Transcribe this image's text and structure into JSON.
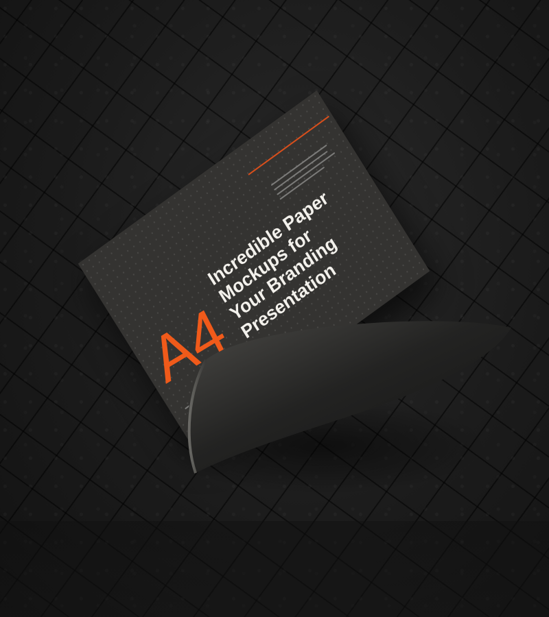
{
  "sheet": {
    "label": "A4",
    "title_lines": [
      "Incredible Paper",
      "Mockups for",
      "Your Branding",
      "Presentation"
    ]
  },
  "colors": {
    "accent": "#f05a1a",
    "paper": "#343331",
    "background": "#1b1b1b",
    "title_text": "#f3f1ec"
  }
}
